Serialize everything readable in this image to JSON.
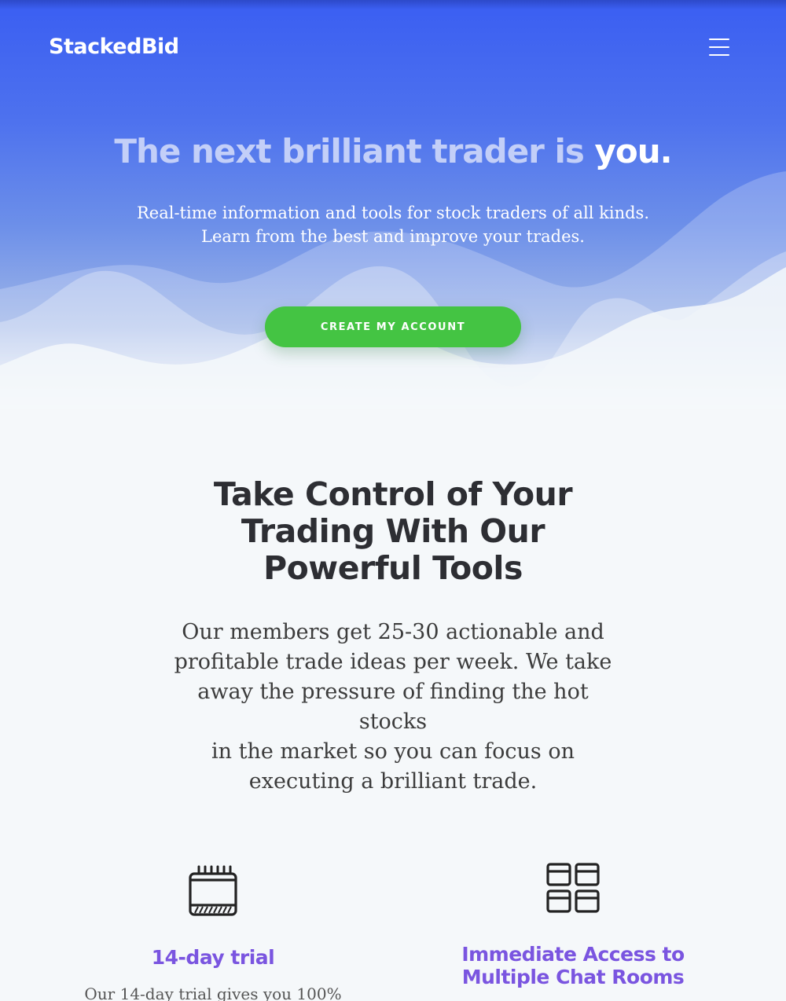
{
  "header": {
    "brand": "StackedBid",
    "menu_icon": "hamburger-menu-icon"
  },
  "hero": {
    "title_muted": "The next brilliant trader is",
    "title_strong": "you.",
    "subtitle_line1": "Real-time information and tools for stock traders of all kinds.",
    "subtitle_line2": "Learn from the best and improve your trades.",
    "cta_label": "CREATE MY ACCOUNT"
  },
  "intro": {
    "title_line1": "Take Control of Your",
    "title_line2": "Trading With Our",
    "title_line3": "Powerful Tools",
    "body_line1": "Our members get 25-30 actionable and",
    "body_line2": "profitable trade ideas per week. We take",
    "body_line3": "away the pressure of finding the hot stocks",
    "body_line4": "in the market so you can focus on",
    "body_line5": "executing a brilliant trade."
  },
  "features": [
    {
      "icon": "calendar-icon",
      "title": "14-day trial",
      "text": "Our 14-day trial gives you 100%"
    },
    {
      "icon": "grid-layout-icon",
      "title_line1": "Immediate Access to",
      "title_line2": "Multiple Chat Rooms"
    }
  ],
  "colors": {
    "hero_gradient_top": "#3a5ef2",
    "cta_green": "#44c443",
    "feature_title_purple": "#7a55e0",
    "heading_dark": "#2d2e33",
    "page_background": "#f5f8fa"
  }
}
